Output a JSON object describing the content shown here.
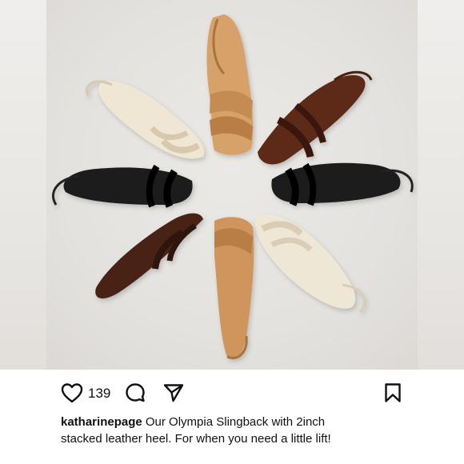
{
  "post": {
    "username": "katharinepage",
    "caption_line1": " Our Olympia Slingback with 2inch",
    "caption_line2": "stacked leather heel. For when you need a little lift!",
    "like_count": "139"
  },
  "photo": {
    "subject": "sandals-arranged-in-a-circle",
    "sandal_colors": [
      "#d9a46b",
      "#5a2a1a",
      "#1b1b1b",
      "#efe8d8",
      "#c98f55",
      "#4a2416",
      "#1c1c1c",
      "#efe6d4"
    ]
  },
  "icons": {
    "like": "heart-icon",
    "comment": "comment-icon",
    "share": "send-icon",
    "save": "bookmark-icon"
  }
}
